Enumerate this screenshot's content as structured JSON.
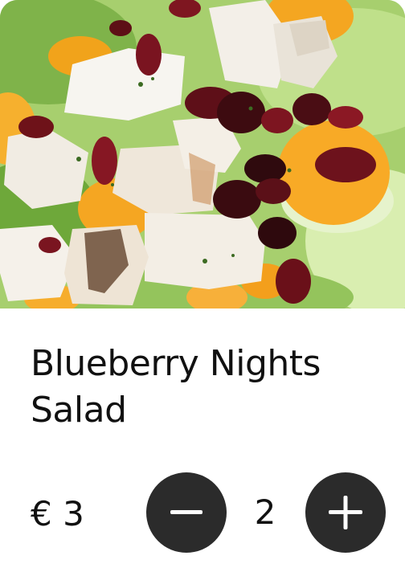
{
  "product": {
    "image_alt": "Salad with chicken, mandarin oranges and dried cranberries",
    "title": "Blueberry Nights Salad",
    "price": "€ 3",
    "quantity": "2"
  },
  "stepper": {
    "decrement_icon": "minus-icon",
    "increment_icon": "plus-icon"
  },
  "colors": {
    "button_background": "#2b2b2b",
    "button_icon": "#ffffff",
    "text": "#111111",
    "card_background": "#ffffff"
  }
}
